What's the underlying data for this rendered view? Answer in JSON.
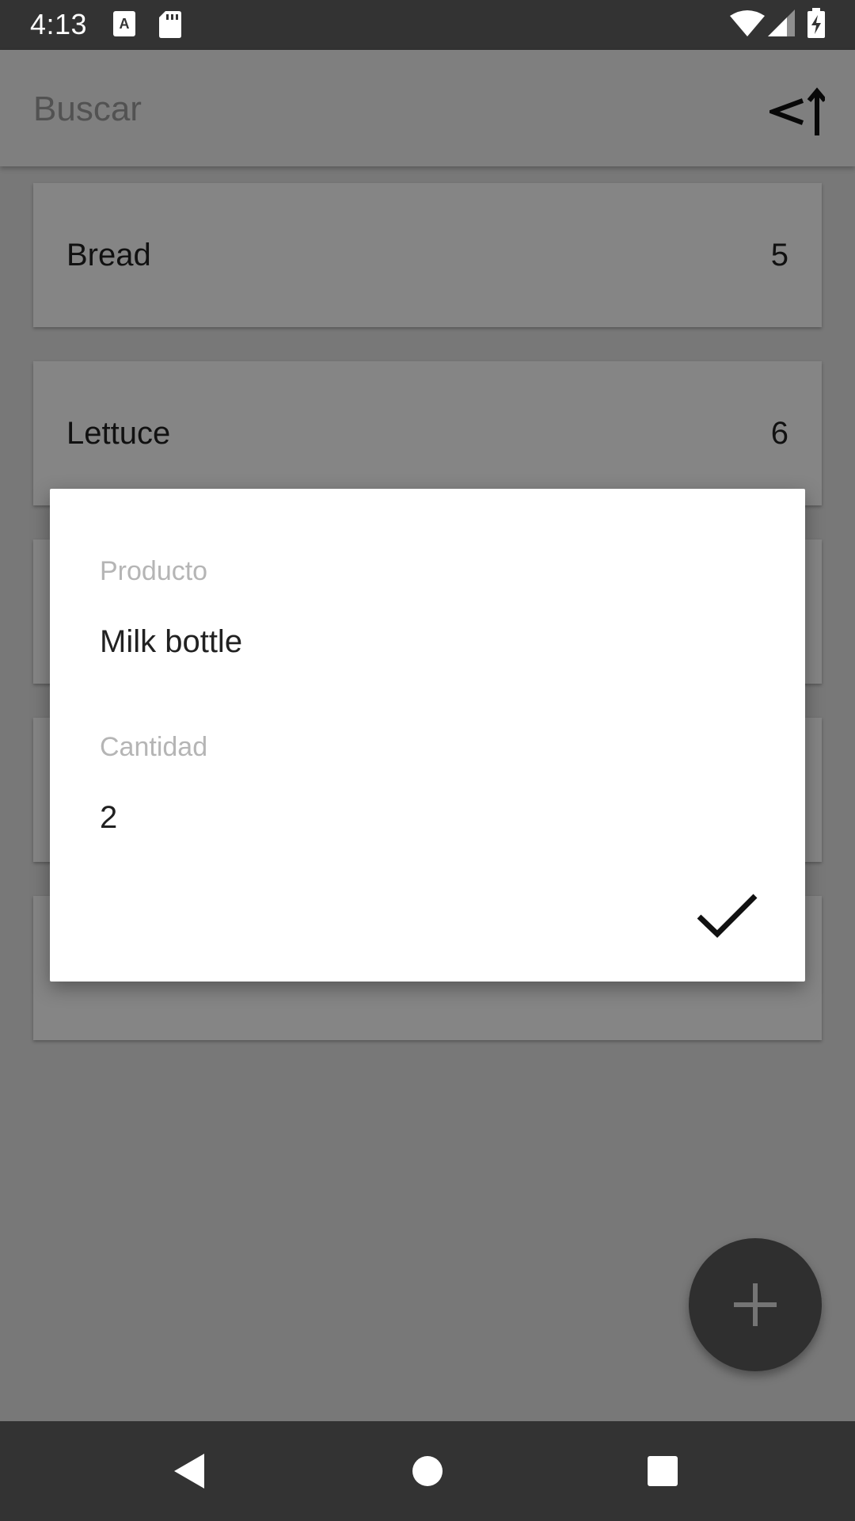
{
  "status_bar": {
    "time": "4:13",
    "icons": [
      "text-a-icon",
      "sd-card-icon",
      "wifi-icon",
      "signal-icon",
      "battery-charging-icon"
    ]
  },
  "app_bar": {
    "search_placeholder": "Buscar",
    "sort_icon": "sort-icon"
  },
  "list": {
    "items": [
      {
        "name": "Bread",
        "quantity": "5"
      },
      {
        "name": "Lettuce",
        "quantity": "6"
      }
    ]
  },
  "dialog": {
    "product_label": "Producto",
    "product_value": "Milk bottle",
    "quantity_label": "Cantidad",
    "quantity_value": "2",
    "confirm_icon": "check-icon"
  },
  "fab": {
    "icon": "plus-icon"
  },
  "nav_bar": {
    "icons": [
      "back-icon",
      "home-icon",
      "recents-icon"
    ]
  },
  "colors": {
    "status_bar": "#333333",
    "fab": "#5a5a5a",
    "scrim": "#000000"
  }
}
